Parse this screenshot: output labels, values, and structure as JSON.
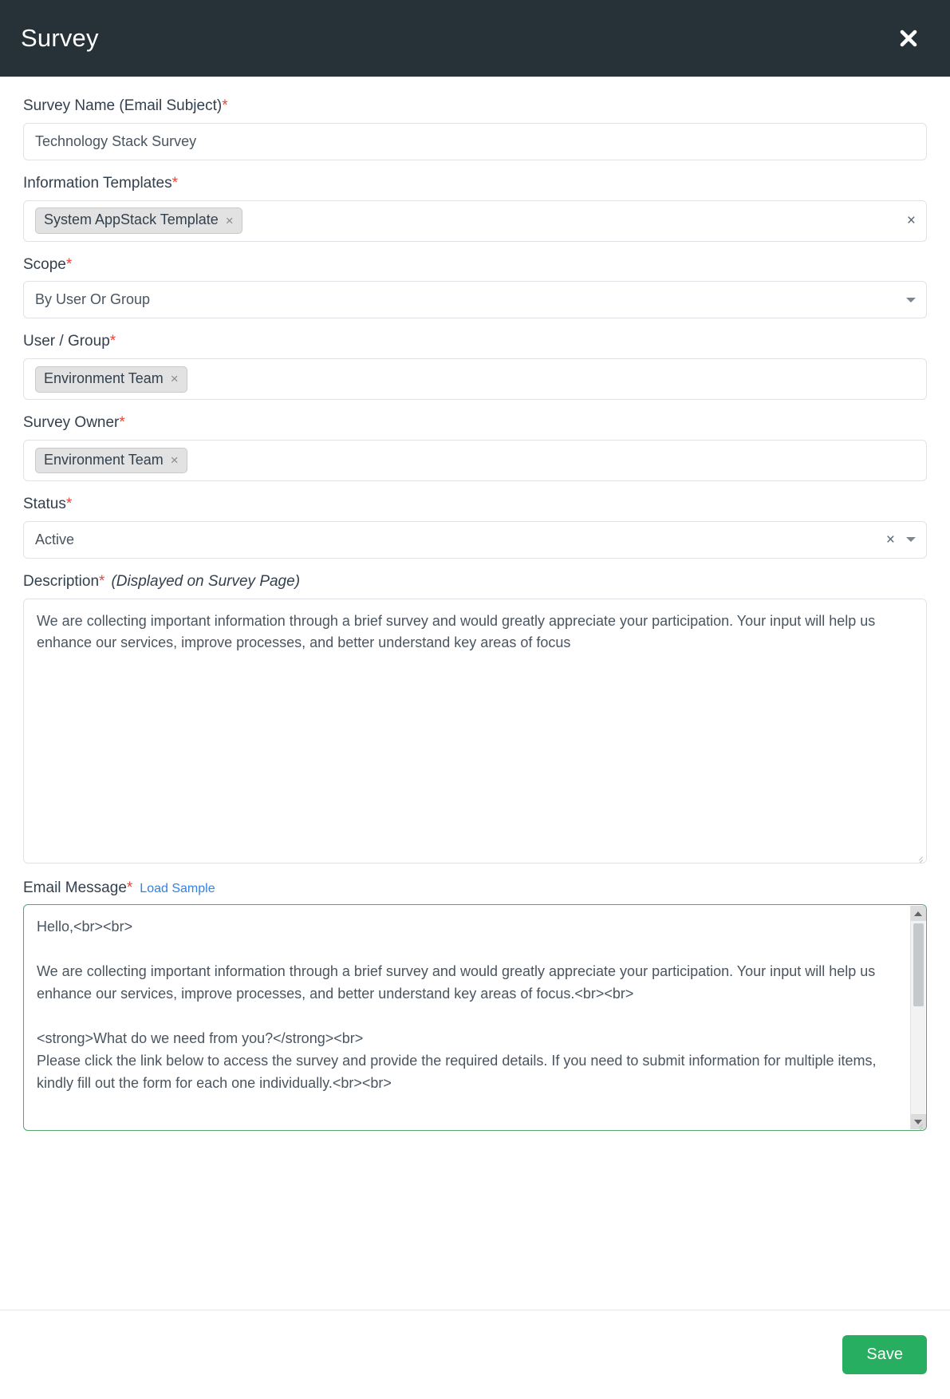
{
  "header": {
    "title": "Survey",
    "close_icon": "close-icon"
  },
  "form": {
    "survey_name": {
      "label": "Survey Name (Email Subject)",
      "required_marker": "*",
      "value": "Technology Stack Survey"
    },
    "information_templates": {
      "label": "Information Templates",
      "required_marker": "*",
      "tags": [
        {
          "text": "System AppStack Template",
          "remove_icon": "×"
        }
      ],
      "clear_icon": "×"
    },
    "scope": {
      "label": "Scope",
      "required_marker": "*",
      "value": "By User Or Group",
      "caret_icon": "chevron-down-icon"
    },
    "user_group": {
      "label": "User / Group ",
      "required_marker": "*",
      "tags": [
        {
          "text": "Environment Team",
          "remove_icon": "×"
        }
      ]
    },
    "survey_owner": {
      "label": "Survey Owner",
      "required_marker": "*",
      "tags": [
        {
          "text": "Environment Team",
          "remove_icon": "×"
        }
      ]
    },
    "status": {
      "label": "Status",
      "required_marker": "*",
      "value": "Active",
      "clear_icon": "×",
      "caret_icon": "chevron-down-icon"
    },
    "description": {
      "label": "Description",
      "required_marker": "*",
      "note": "(Displayed on Survey Page)",
      "value": "We are collecting important information through a brief survey and would greatly appreciate your participation. Your input will help us enhance our services, improve processes, and better understand key areas of focus"
    },
    "email_message": {
      "label": "Email Message",
      "required_marker": "*",
      "load_sample_link": "Load Sample",
      "value": "Hello,<br><br>\n\nWe are collecting important information through a brief survey and would greatly appreciate your participation. Your input will help us enhance our services, improve processes, and better understand key areas of focus.<br><br>\n\n<strong>What do we need from you?</strong><br>\nPlease click the link below to access the survey and provide the required details. If you need to submit information for multiple items, kindly fill out the form for each one individually.<br><br>"
    }
  },
  "footer": {
    "save_label": "Save"
  },
  "colors": {
    "header_bg": "#263238",
    "accent_link": "#2f82e6",
    "required": "#e8463a",
    "save_green": "#27ae60",
    "email_border_green": "#54a869"
  }
}
